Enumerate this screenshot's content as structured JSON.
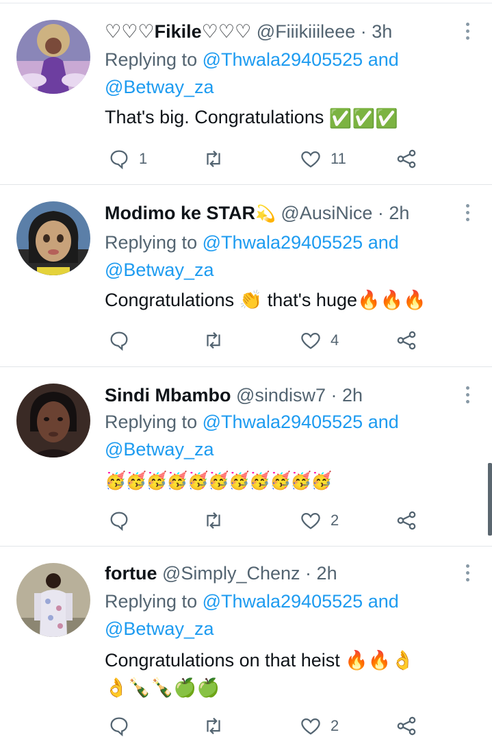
{
  "replying_prefix": "Replying to",
  "and_word": "and",
  "tweets": [
    {
      "display_name": "♡♡♡Fikile♡♡♡",
      "handle": "@Fiiikiiileee",
      "dot": "·",
      "time": "3h",
      "mentions": [
        "@Thwala29405525",
        "@Betway_za"
      ],
      "text": "That's big. Congratulations ",
      "emoji_text": "✅✅✅",
      "reply_count": "1",
      "retweet_count": "",
      "like_count": "11",
      "avatar_icon": "avatar-woman-purple-art"
    },
    {
      "display_name": "Modimo ke STAR",
      "name_emoji": "💫",
      "handle": "@AusiNice",
      "dot": "·",
      "time": "2h",
      "mentions": [
        "@Thwala29405525",
        "@Betway_za"
      ],
      "text": "Congratulations 👏 that's huge🔥🔥🔥",
      "reply_count": "",
      "retweet_count": "",
      "like_count": "4",
      "avatar_icon": "avatar-doll-cartoon"
    },
    {
      "display_name": "Sindi Mbambo",
      "handle": "@sindisw7",
      "dot": "·",
      "time": "2h",
      "mentions": [
        "@Thwala29405525",
        "@Betway_za"
      ],
      "text": "🥳🥳🥳🥳🥳🥳🥳🥳🥳🥳🥳",
      "reply_count": "",
      "retweet_count": "",
      "like_count": "2",
      "avatar_icon": "avatar-woman-portrait"
    },
    {
      "display_name": "fortue",
      "handle": "@Simply_Chenz",
      "dot": "·",
      "time": "2h",
      "mentions": [
        "@Thwala29405525",
        "@Betway_za"
      ],
      "text": "Congratulations on that heist 🔥🔥👌",
      "text_line2": "👌🍾🍾🍏🍏",
      "reply_count": "",
      "retweet_count": "",
      "like_count": "2",
      "avatar_icon": "avatar-man-floral-shirt"
    }
  ],
  "colors": {
    "accent": "#1d9bf0",
    "secondary_text": "#536471",
    "icon": "#536471"
  }
}
